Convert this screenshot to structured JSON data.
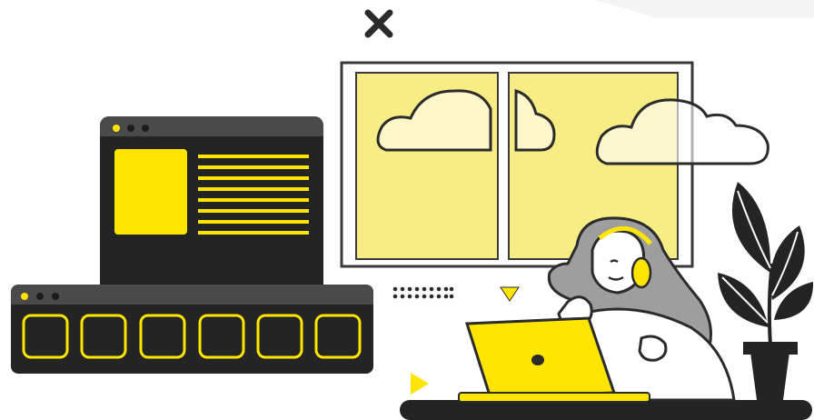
{
  "palette": {
    "accent": "#FFE500",
    "accent_soft": "#F7EE8A",
    "dark": "#242424",
    "mid": "#4A4A4A",
    "light": "#F4F4F4",
    "stroke": "#1F1F1F"
  },
  "icons": [
    "close-icon",
    "play-triangle-icon",
    "down-triangle-icon",
    "dot-grid-icon",
    "cloud-icon",
    "plant-icon",
    "headset-icon",
    "laptop-icon"
  ]
}
